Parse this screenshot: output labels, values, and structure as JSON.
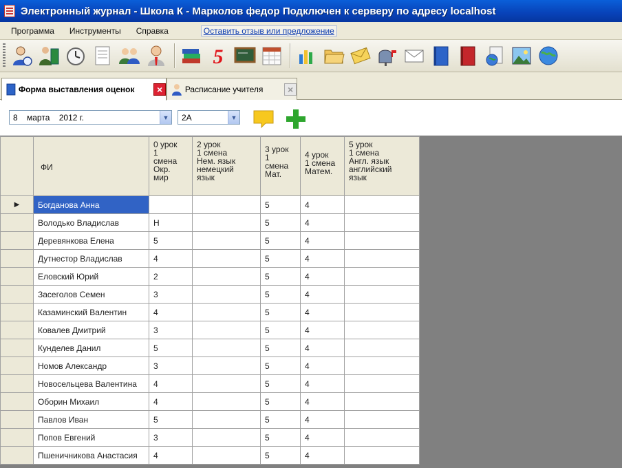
{
  "window": {
    "title": "Электронный журнал - Школа К - Марколов федор Подключен к серверу по адресу localhost"
  },
  "menu": {
    "items": [
      "Программа",
      "Инструменты",
      "Справка"
    ],
    "feedback_link": "Оставить отзыв или предложение"
  },
  "toolbar": {
    "icons": [
      "user-icon",
      "teacher-book-icon",
      "clock-icon",
      "document-icon",
      "group-icon",
      "person-icon",
      "books-icon",
      "grade-five-icon",
      "blackboard-icon",
      "calendar-icon",
      "chart-icon",
      "folder-icon",
      "envelope-icon",
      "mailbox-icon",
      "letter-icon",
      "blue-book-icon",
      "red-book-icon",
      "world-doc-icon",
      "picture-icon",
      "globe-icon"
    ],
    "grade_glyph": "5"
  },
  "tabs": [
    {
      "label": "Форма выставления оценок",
      "close": "×"
    },
    {
      "label": "Расписание учителя",
      "close": "×"
    }
  ],
  "filters": {
    "date": "8    марта    2012 г.",
    "class": "2А"
  },
  "grid": {
    "columns": [
      {
        "header": "ФИ",
        "lines": [
          "ФИ"
        ]
      },
      {
        "lines": [
          "0 урок",
          "1",
          "смена",
          "Окр.",
          "мир"
        ]
      },
      {
        "lines": [
          "2 урок",
          "1 смена",
          "Нем. язык",
          "немецкий",
          "язык"
        ]
      },
      {
        "lines": [
          "3 урок",
          "1",
          "смена",
          "Мат."
        ]
      },
      {
        "lines": [
          "4 урок",
          "1 смена",
          "Матем."
        ]
      },
      {
        "lines": [
          "5 урок",
          "1 смена",
          "Англ. язык",
          "английский",
          "язык"
        ]
      }
    ],
    "rows": [
      {
        "name": "Богданова Анна",
        "c0": "",
        "c2": "",
        "c3": "5",
        "c4": "4",
        "c5": ""
      },
      {
        "name": "Володько Владислав",
        "c0": "Н",
        "c2": "",
        "c3": "5",
        "c4": "4",
        "c5": ""
      },
      {
        "name": "Деревянкова Елена",
        "c0": "5",
        "c2": "",
        "c3": "5",
        "c4": "4",
        "c5": ""
      },
      {
        "name": "Дутнестор Владислав",
        "c0": "4",
        "c2": "",
        "c3": "5",
        "c4": "4",
        "c5": ""
      },
      {
        "name": "Еловский Юрий",
        "c0": "2",
        "c2": "",
        "c3": "5",
        "c4": "4",
        "c5": ""
      },
      {
        "name": "Засеголов Семен",
        "c0": "3",
        "c2": "",
        "c3": "5",
        "c4": "4",
        "c5": ""
      },
      {
        "name": "Казаминский Валентин",
        "c0": "4",
        "c2": "",
        "c3": "5",
        "c4": "4",
        "c5": ""
      },
      {
        "name": "Ковалев Дмитрий",
        "c0": "3",
        "c2": "",
        "c3": "5",
        "c4": "4",
        "c5": ""
      },
      {
        "name": "Кунделев Данил",
        "c0": "5",
        "c2": "",
        "c3": "5",
        "c4": "4",
        "c5": ""
      },
      {
        "name": "Номов Александр",
        "c0": "3",
        "c2": "",
        "c3": "5",
        "c4": "4",
        "c5": ""
      },
      {
        "name": "Новосельцева Валентина",
        "c0": "4",
        "c2": "",
        "c3": "5",
        "c4": "4",
        "c5": ""
      },
      {
        "name": "Оборин Михаил",
        "c0": "4",
        "c2": "",
        "c3": "5",
        "c4": "4",
        "c5": ""
      },
      {
        "name": "Павлов Иван",
        "c0": "5",
        "c2": "",
        "c3": "5",
        "c4": "4",
        "c5": ""
      },
      {
        "name": "Попов Евгений",
        "c0": "3",
        "c2": "",
        "c3": "5",
        "c4": "4",
        "c5": ""
      },
      {
        "name": "Пшеничникова Анастасия",
        "c0": "4",
        "c2": "",
        "c3": "5",
        "c4": "4",
        "c5": ""
      }
    ],
    "current_row_marker": "▶"
  },
  "colors": {
    "title_bar": "#0842b8",
    "selection": "#3163c5",
    "grade_five": "#e0151b",
    "add_plus": "#2ea62e"
  }
}
